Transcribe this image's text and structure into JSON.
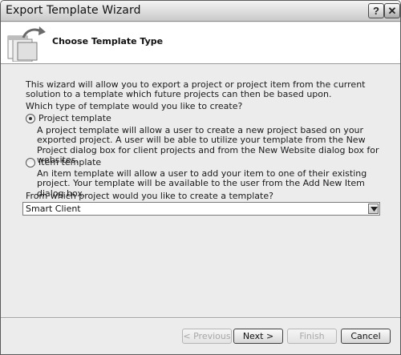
{
  "window": {
    "title": "Export Template Wizard",
    "help_label": "?",
    "close_label": "✕"
  },
  "header": {
    "title": "Choose Template Type",
    "icon": "export-template-icon"
  },
  "body": {
    "intro": "This wizard will allow you to export a project or project item from the current solution to a template which future projects can then be based upon.",
    "question": "Which type of template would you like to create?",
    "options": [
      {
        "label": "Project template",
        "checked": true,
        "description": "A project template will allow a user to create a new project based on your exported project. A user will be able to utilize your template from the New Project dialog box for client projects and from the New Website dialog box for websites."
      },
      {
        "label": "Item template",
        "checked": false,
        "description": "An item template will allow a user to add your item to one of their existing project. Your template will be available to the user from the Add New Item dialog box."
      }
    ],
    "project_select": {
      "label": "From which project would you like to create a template?",
      "value": "Smart Client"
    }
  },
  "footer": {
    "previous_label": "< Previous",
    "next_label": "Next >",
    "finish_label": "Finish",
    "cancel_label": "Cancel"
  }
}
